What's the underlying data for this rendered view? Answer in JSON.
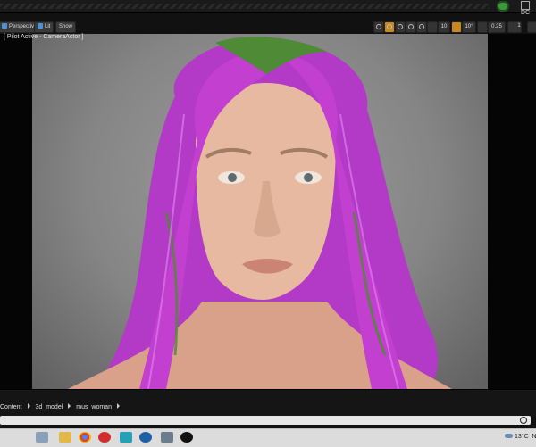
{
  "viewport": {
    "mode_label": "Perspective",
    "lit_label": "Lit",
    "show_label": "Show",
    "pilot_text": "[ Pilot Active - CameraActor ]",
    "grid_snap": "10",
    "angle_snap": "10°",
    "scale_snap": "0.25",
    "camera_speed": "1"
  },
  "content_browser": {
    "breadcrumb": [
      "Content",
      "3d_model",
      "mus_woman"
    ]
  },
  "taskbar": {
    "weather": "13°C",
    "trailing": "N"
  },
  "colors": {
    "accent_orange": "#c9881f",
    "accent_blue": "#4f8fd6",
    "source_control_green": "#3c9a3c",
    "hair_magenta": "#c23fd0",
    "hair_green": "#4f8a37"
  },
  "icons": [
    "source-control-icon",
    "settings-grid-icon",
    "translate-icon",
    "rotate-icon",
    "scale-icon",
    "world-local-icon",
    "surface-snap-icon",
    "grid-snap-icon",
    "angle-snap-icon",
    "scale-snap-icon",
    "camera-speed-icon",
    "maximize-icon",
    "folder-icon",
    "chrome-icon",
    "opera-icon",
    "maya-icon",
    "c-app-icon",
    "photos-icon",
    "unreal-icon",
    "weather-cloud-icon"
  ]
}
